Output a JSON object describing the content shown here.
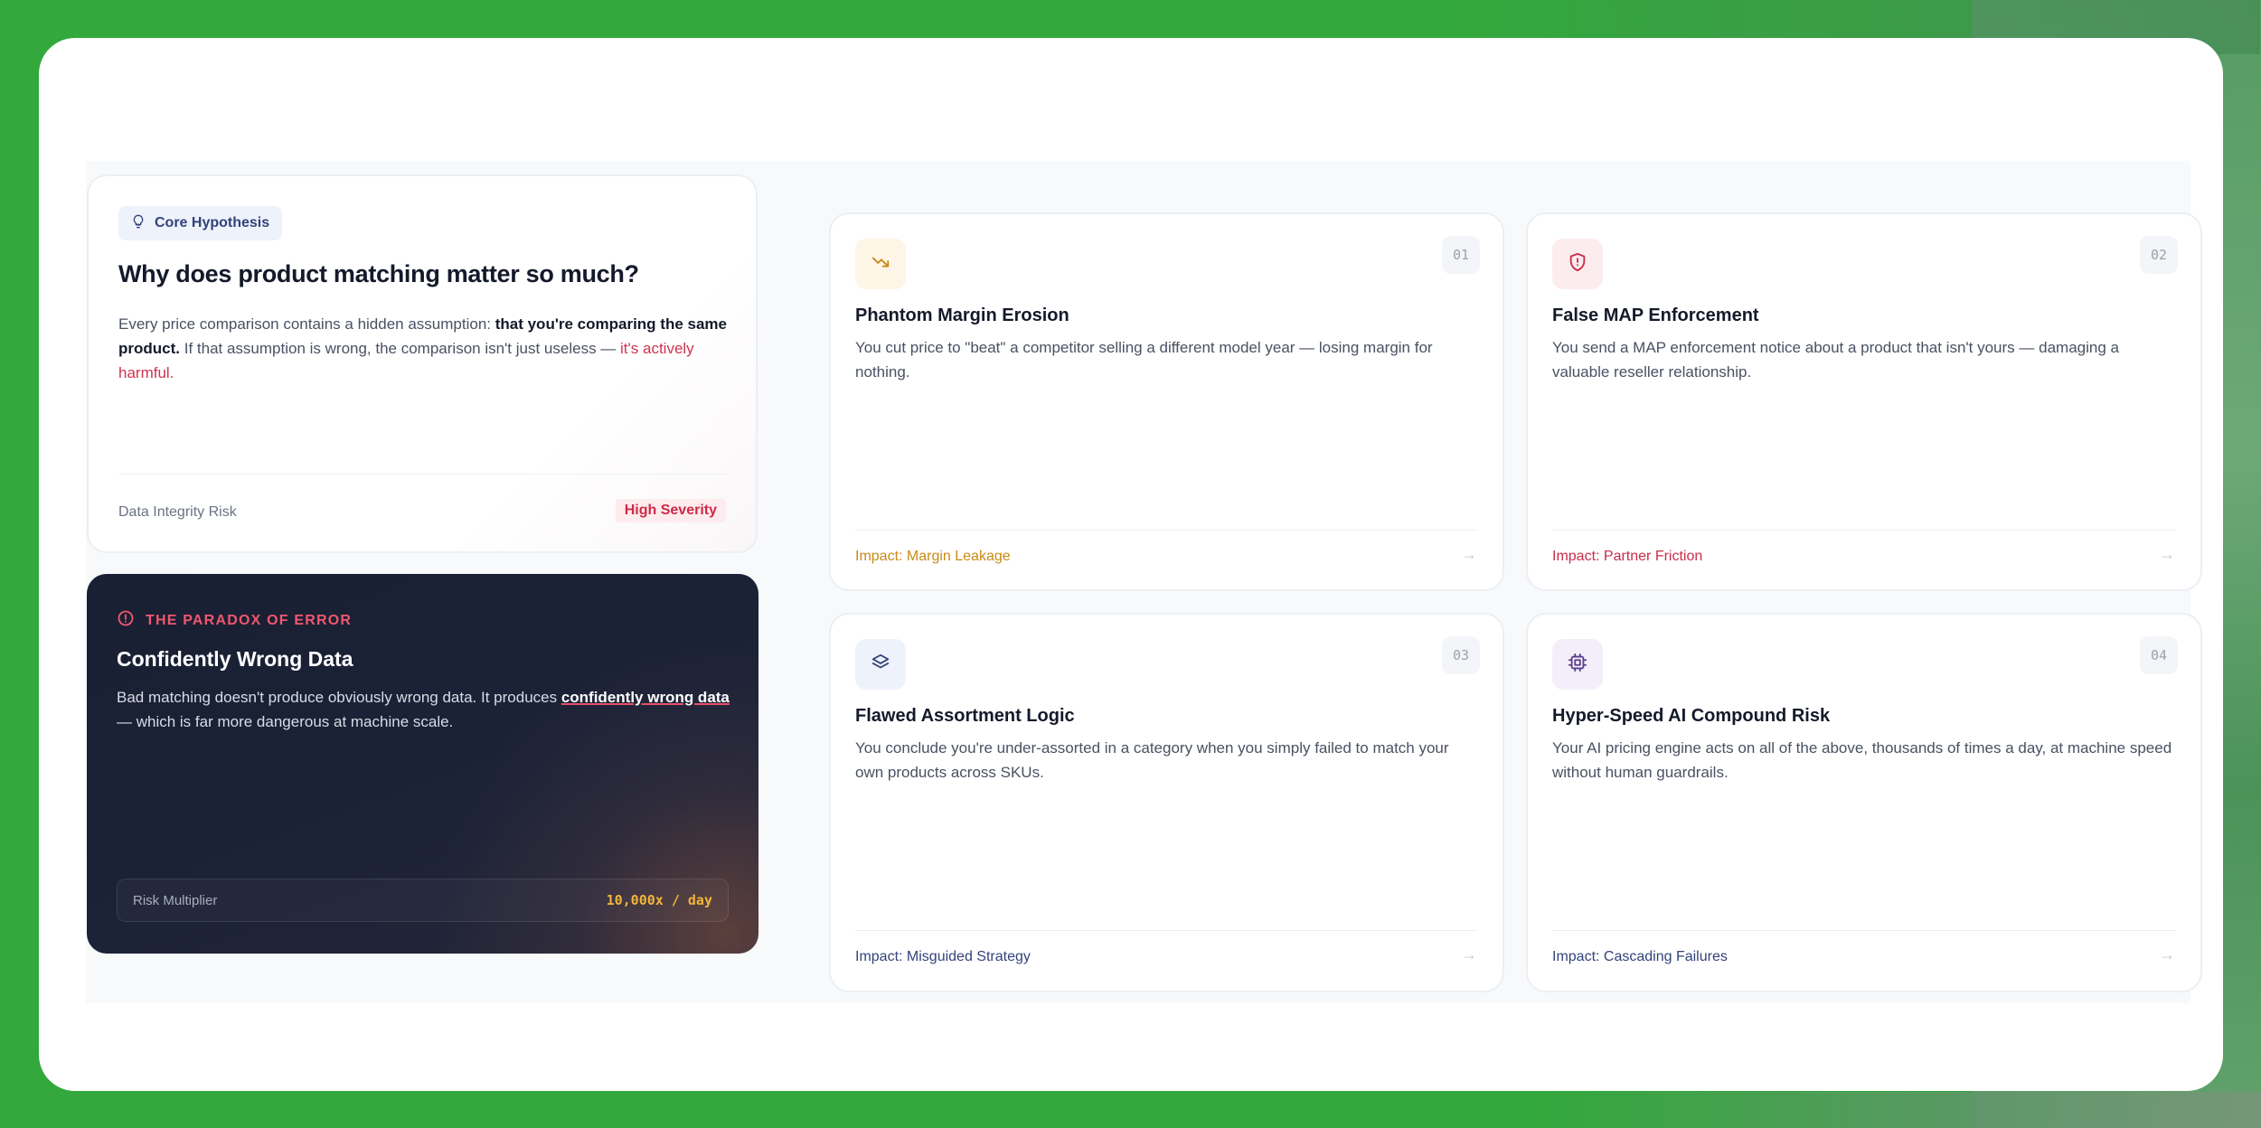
{
  "hypothesis": {
    "pill_label": "Core Hypothesis",
    "title": "Why does product matching matter so much?",
    "body_1": "Every price comparison contains a hidden assumption: ",
    "body_bold": "that you're comparing the same product.",
    "body_2": " If that assumption is wrong, the comparison isn't just useless — ",
    "body_red": "it's actively harmful.",
    "footer_label": "Data Integrity Risk",
    "severity": "High Severity"
  },
  "paradox": {
    "eyebrow": "THE PARADOX OF ERROR",
    "title": "Confidently Wrong Data",
    "body_1": "Bad matching doesn't produce obviously wrong data. It produces ",
    "body_emph": "confidently wrong data",
    "body_2": " — which is far more dangerous at machine scale.",
    "risk_label": "Risk Multiplier",
    "risk_value": "10,000x / day"
  },
  "impacts": [
    {
      "number": "01",
      "title": "Phantom Margin Erosion",
      "body": "You cut price to \"beat\" a competitor selling a different model year — losing margin for nothing.",
      "impact": "Impact: Margin Leakage",
      "icon": "trending-down-icon",
      "accent": "#c98a14",
      "icon_bg": "#fdf5e6"
    },
    {
      "number": "02",
      "title": "False MAP Enforcement",
      "body": "You send a MAP enforcement notice about a product that isn't yours — damaging a valuable reseller relationship.",
      "impact": "Impact: Partner Friction",
      "icon": "shield-alert-icon",
      "accent": "#c92c48",
      "icon_bg": "#fdecee"
    },
    {
      "number": "03",
      "title": "Flawed Assortment Logic",
      "body": "You conclude you're under-assorted in a category when you simply failed to match your own products across SKUs.",
      "impact": "Impact: Misguided Strategy",
      "icon": "layers-icon",
      "accent": "#33437a",
      "icon_bg": "#eef2fb"
    },
    {
      "number": "04",
      "title": "Hyper-Speed AI Compound Risk",
      "body": "Your AI pricing engine acts on all of the above, thousands of times a day, at machine speed without human guardrails.",
      "impact": "Impact: Cascading Failures",
      "icon": "cpu-icon",
      "accent": "#5b3f8c",
      "icon_bg": "#f3effa"
    }
  ],
  "arrow_glyph": "→"
}
